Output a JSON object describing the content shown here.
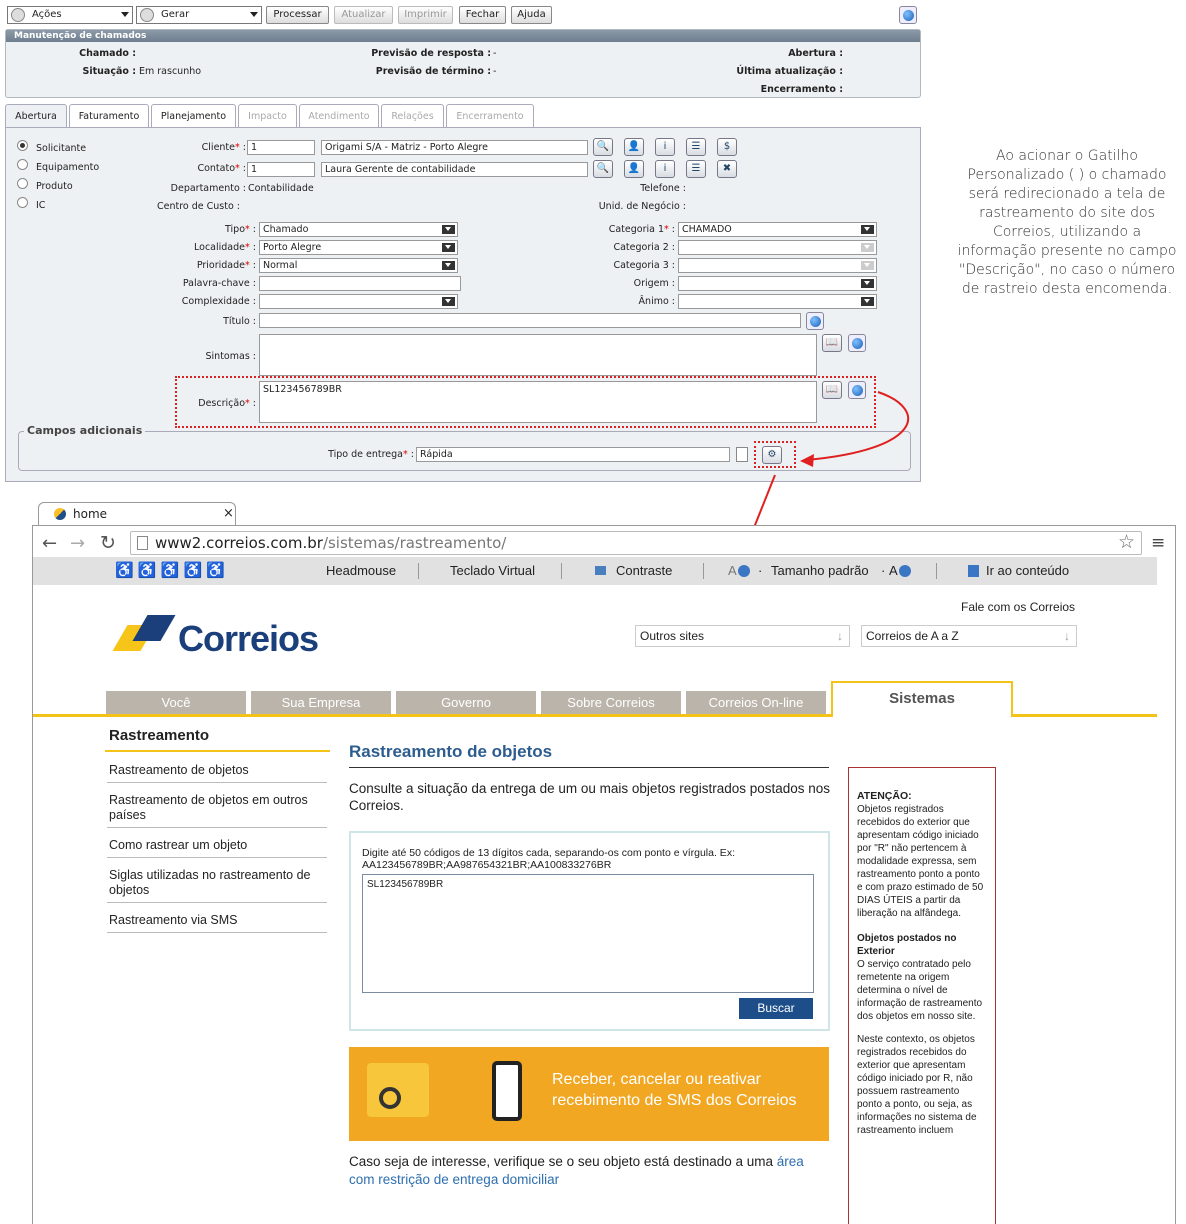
{
  "toolbar": {
    "acoes": "Ações",
    "gerar": "Gerar",
    "processar": "Processar",
    "atualizar": "Atualizar",
    "imprimir": "Imprimir",
    "fechar": "Fechar",
    "ajuda": "Ajuda"
  },
  "panel": {
    "title": "Manutenção de chamados",
    "chamado_label": "Chamado :",
    "situacao_label": "Situação :",
    "situacao_value": "Em rascunho",
    "prev_resposta_label": "Previsão de resposta :",
    "prev_resposta_value": "-",
    "prev_termino_label": "Previsão de término :",
    "prev_termino_value": "-",
    "abertura_label": "Abertura :",
    "ultima_label": "Última atualização :",
    "encerramento_label": "Encerramento :"
  },
  "tabs": [
    "Abertura",
    "Faturamento",
    "Planejamento",
    "Impacto",
    "Atendimento",
    "Relações",
    "Encerramento"
  ],
  "radios": [
    "Solicitante",
    "Equipamento",
    "Produto",
    "IC"
  ],
  "form": {
    "cliente_label": "Cliente",
    "cliente_code": "1",
    "cliente_name": "Origami S/A - Matriz - Porto Alegre",
    "contato_label": "Contato",
    "contato_code": "1",
    "contato_name": "Laura Gerente de contabilidade",
    "departamento_label": "Departamento :",
    "departamento_value": "Contabilidade",
    "telefone_label": "Telefone :",
    "centro_label": "Centro de Custo :",
    "unid_label": "Unid. de Negócio :",
    "tipo_label": "Tipo",
    "tipo_value": "Chamado",
    "localidade_label": "Localidade",
    "localidade_value": "Porto Alegre",
    "prioridade_label": "Prioridade",
    "prioridade_value": "Normal",
    "palavra_label": "Palavra-chave :",
    "complexidade_label": "Complexidade :",
    "categoria1_label": "Categoria 1",
    "categoria1_value": "CHAMADO",
    "categoria2_label": "Categoria 2 :",
    "categoria3_label": "Categoria 3 :",
    "origem_label": "Origem :",
    "animo_label": "Ânimo :",
    "titulo_label": "Título :",
    "sintomas_label": "Sintomas :",
    "descricao_label": "Descrição",
    "descricao_value": "SL123456789BR",
    "campos_adicionais": "Campos adicionais",
    "tipo_entrega_label": "Tipo de entrega",
    "tipo_entrega_value": "Rápida",
    "colon": ":",
    "asterisk": "*"
  },
  "note": "Ao acionar o Gatilho Personalizado ( ) o chamado será redirecionado a tela de rastreamento do site dos Correios, utilizando a informação presente no campo \"Descrição\", no caso o número de rastreio desta encomenda.",
  "browser": {
    "tab_title": "home",
    "url_host": "www2.correios.com.br",
    "url_path": "/sistemas/rastreamento/"
  },
  "correios": {
    "acc": {
      "headmouse": "Headmouse",
      "teclado": "Teclado Virtual",
      "contraste": "Contraste",
      "tamanho": "Tamanho padrão",
      "a_minus": "A",
      "a_plus": "A",
      "dot": "·",
      "ir": "Ir ao conteúdo"
    },
    "logo": "Correios",
    "fale": "Fale com os Correios",
    "outros": "Outros sites",
    "aaz": "Correios de A a Z",
    "nav": [
      "Você",
      "Sua Empresa",
      "Governo",
      "Sobre Correios",
      "Correios On-line"
    ],
    "nav_active": "Sistemas",
    "side_title": "Rastreamento",
    "side_items": [
      "Rastreamento de objetos",
      "Rastreamento de objetos em outros países",
      "Como rastrear um objeto",
      "Siglas utilizadas no rastreamento de objetos",
      "Rastreamento via SMS"
    ],
    "main_title": "Rastreamento de objetos",
    "intro": "Consulte a situação da entrega de um ou mais objetos registrados postados nos Correios.",
    "hint": "Digite até 50 códigos de 13 dígitos cada, separando-os com ponto e vírgula. Ex: AA123456789BR;AA987654321BR;AA100833276BR",
    "codes": "SL123456789BR",
    "buscar": "Buscar",
    "banner": "Receber, cancelar ou reativar recebimento de SMS dos Correios",
    "footer_text": "Caso seja de interesse, verifique se o seu objeto está destinado a uma ",
    "footer_link": "área com restrição de entrega domiciliar",
    "atencao_title": "ATENÇÃO:",
    "atencao_p1": "Objetos registrados recebidos do exterior que apresentam código iniciado por \"R\" não pertencem à modalidade expressa, sem rastreamento ponto a ponto e com prazo estimado de 50 DIAS ÚTEIS a partir da liberação na alfândega.",
    "atencao_sub": "Objetos postados no Exterior",
    "atencao_p2": "O serviço contratado pelo remetente na origem determina o nível de informação de rastreamento dos objetos em nosso site.",
    "atencao_p3": "Neste contexto, os objetos registrados recebidos do exterior que apresentam código iniciado por R, não possuem rastreamento ponto a ponto, ou seja, as informações no sistema de rastreamento incluem"
  }
}
